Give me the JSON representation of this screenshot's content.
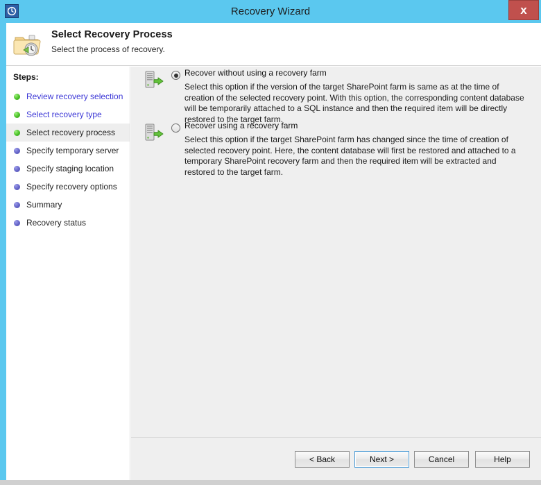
{
  "window": {
    "title": "Recovery Wizard",
    "close_label": "x",
    "app_icon": "clock-restore-icon",
    "title_bar_color": "#5bc8ef",
    "close_button_color": "#c0504d"
  },
  "header": {
    "icon": "folder-clock-icon",
    "title": "Select Recovery Process",
    "subtitle": "Select the process of recovery."
  },
  "sidebar": {
    "label": "Steps:",
    "items": [
      {
        "label": "Review recovery selection",
        "state": "done",
        "link": true
      },
      {
        "label": "Select recovery type",
        "state": "done",
        "link": true
      },
      {
        "label": "Select recovery process",
        "state": "done",
        "link": false,
        "current": true
      },
      {
        "label": "Specify temporary server",
        "state": "todo",
        "link": false
      },
      {
        "label": "Specify staging location",
        "state": "todo",
        "link": false
      },
      {
        "label": "Specify recovery options",
        "state": "todo",
        "link": false
      },
      {
        "label": "Summary",
        "state": "todo",
        "link": false
      },
      {
        "label": "Recovery status",
        "state": "todo",
        "link": false
      }
    ],
    "bullet_done_color": "#49c026",
    "bullet_todo_color": "#6464c8",
    "link_color": "#3b36d6",
    "current_row_background": "#eeeeee"
  },
  "main": {
    "options": [
      {
        "icon": "server-restore-icon",
        "label": "Recover without using a recovery farm",
        "selected": true,
        "description": "Select this option if the version of the target SharePoint farm is same as at the time of creation of the selected recovery point. With this option, the corresponding content database will be temporarily attached to a SQL instance and then the required item will be directly restored to the target farm."
      },
      {
        "icon": "server-restore-icon",
        "label": "Recover using a recovery farm",
        "selected": false,
        "description": "Select this option if the target SharePoint farm has changed since the time of creation of selected recovery point. Here, the content database will first be restored and attached to a temporary SharePoint recovery farm and then the required item will be extracted and restored to the target farm."
      }
    ],
    "background_color": "#efefef"
  },
  "buttons": {
    "back": "< Back",
    "next": "Next >",
    "cancel": "Cancel",
    "help": "Help"
  }
}
